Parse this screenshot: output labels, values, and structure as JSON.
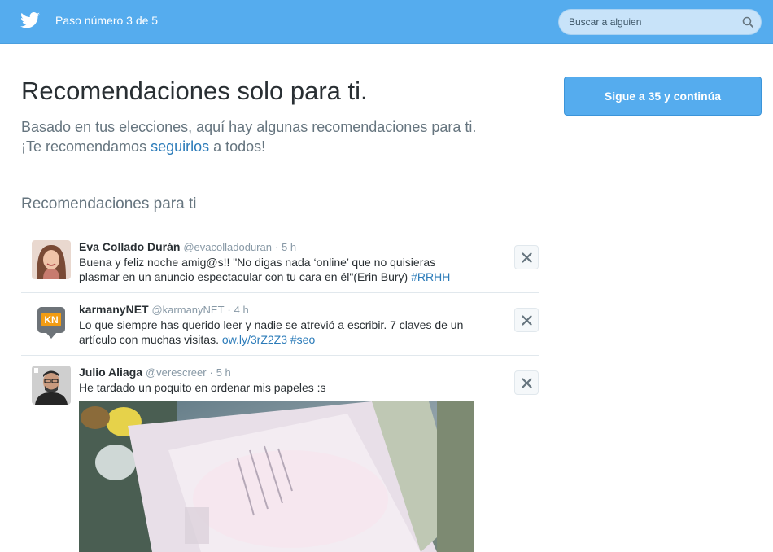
{
  "header": {
    "step_text": "Paso número 3 de 5",
    "search_placeholder": "Buscar a alguien"
  },
  "main": {
    "title": "Recomendaciones solo para ti.",
    "subtitle_part1": "Basado en tus elecciones, aquí hay algunas recomendaciones para ti. ¡Te recomendamos ",
    "subtitle_link": "seguirlos",
    "subtitle_part2": " a todos!",
    "follow_button": "Sigue a 35 y continúa",
    "section_title": "Recomendaciones para ti"
  },
  "recommendations": [
    {
      "name": "Eva Collado Durán",
      "handle": "@evacolladoduran",
      "time": "5 h",
      "text": "Buena y feliz noche amig@s!! \"No digas nada ‘online’ que no quisieras plasmar en un anuncio espectacular con tu cara en él\"(Erin Bury) ",
      "tag": "#RRHH"
    },
    {
      "name": "karmanyNET",
      "handle": "@karmanyNET",
      "time": "4 h",
      "text": "Lo que siempre has querido leer y nadie se atrevió a escribir. 7 claves de un artículo con muchas visitas. ",
      "link": "ow.ly/3rZ2Z3",
      "tag": "#seo",
      "avatar_text": "KN"
    },
    {
      "name": "Julio Aliaga",
      "handle": "@verescreer",
      "time": "5 h",
      "text": "He tardado un poquito en ordenar mis  papeles :s"
    }
  ],
  "colors": {
    "brand": "#55acee",
    "link": "#2b7bb9",
    "muted": "#66757f"
  }
}
